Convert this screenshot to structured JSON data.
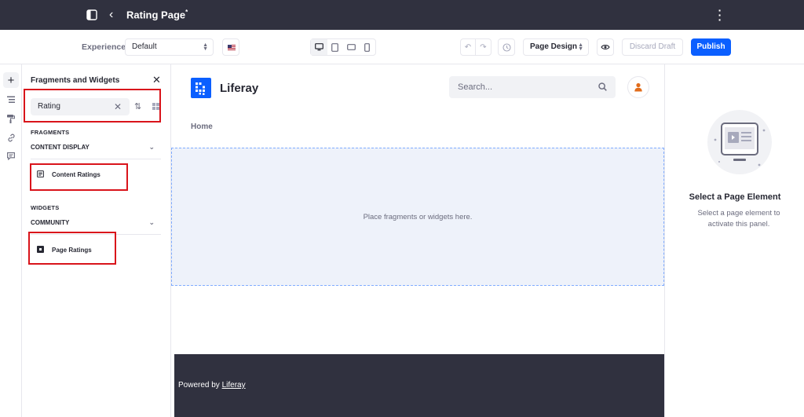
{
  "topbar": {
    "page_title": "Rating Page",
    "draft_marker": "*",
    "back_icon": "chevron-left-icon",
    "sidebar_icon": "sidebar-toggle-icon",
    "menu_icon": "kebab-icon"
  },
  "toolbar": {
    "experience_label": "Experience",
    "experience_value": "Default",
    "language_icon": "us-flag-icon",
    "devices": [
      "desktop",
      "tablet",
      "landscape-phone",
      "portrait-phone"
    ],
    "page_design_label": "Page Design",
    "discard_label": "Discard Draft",
    "publish_label": "Publish",
    "publish_color": "#0b5fff"
  },
  "sidebar_rail": {
    "items": [
      "add-icon",
      "browser-icon",
      "paint-roller-icon",
      "link-icon",
      "comments-icon"
    ]
  },
  "fragments_panel": {
    "title": "Fragments and Widgets",
    "search_value": "Rating",
    "fragments_heading": "FRAGMENTS",
    "fragments_category": "CONTENT DISPLAY",
    "fragment_item": "Content Ratings",
    "widgets_heading": "WIDGETS",
    "widgets_category": "COMMUNITY",
    "widget_item": "Page Ratings",
    "highlight_color": "#d9141b"
  },
  "site": {
    "name": "Liferay",
    "search_placeholder": "Search...",
    "nav_home": "Home",
    "dropzone_text": "Place fragments or widgets here.",
    "footer_prefix": "Powered by",
    "footer_link": "Liferay"
  },
  "right_panel": {
    "heading": "Select a Page Element",
    "description": "Select a page element to activate this panel."
  }
}
